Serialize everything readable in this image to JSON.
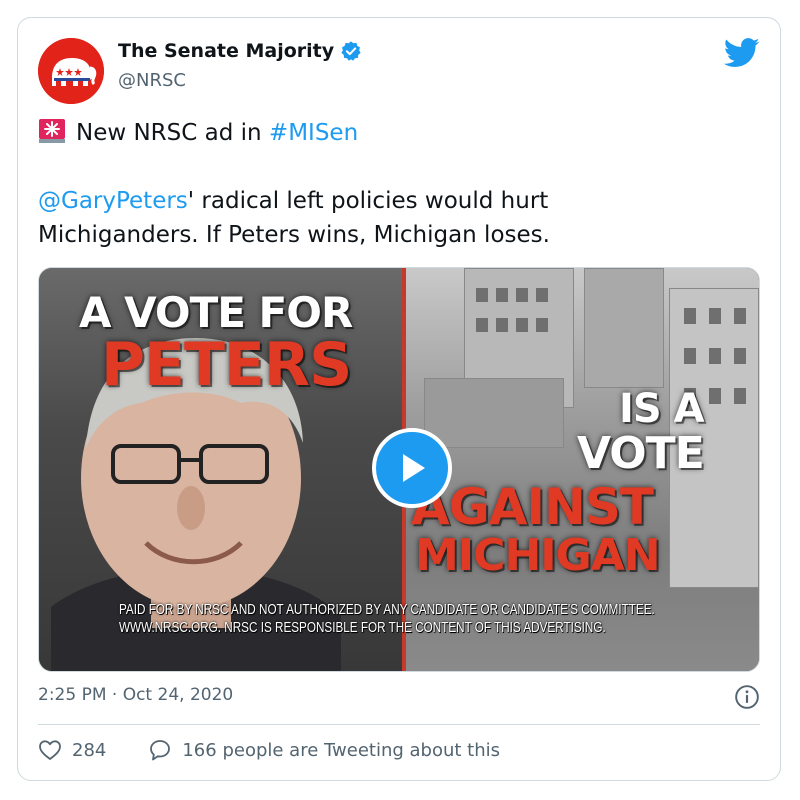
{
  "author": {
    "display_name": "The Senate Majority",
    "handle": "@NRSC",
    "verified": true,
    "avatar": "nrsc-elephant-logo"
  },
  "tweet": {
    "line1_text": "New NRSC ad in ",
    "line1_hashtag": "#MISen",
    "line1_icon": "rotating-light-emoji",
    "mention": "@GaryPeters",
    "body_after_mention": "' radical left policies would hurt",
    "body_line2": "Michiganders. If Peters wins, Michigan loses."
  },
  "media": {
    "type": "video",
    "overlay_left_line1": "A VOTE FOR",
    "overlay_left_line2": "PETERS",
    "overlay_right_line1": "IS A",
    "overlay_right_line2": "VOTE",
    "overlay_right_line3": "AGAINST",
    "overlay_right_line4": "MICHIGAN",
    "disclaimer_line1": "PAID FOR BY NRSC AND NOT AUTHORIZED BY ANY CANDIDATE OR CANDIDATE'S COMMITTEE.",
    "disclaimer_line2": "WWW.NRSC.ORG. NRSC IS RESPONSIBLE FOR THE CONTENT OF THIS ADVERTISING."
  },
  "timestamp": "2:25 PM · Oct 24, 2020",
  "actions": {
    "likes": "284",
    "conversation": "166 people are Tweeting about this"
  },
  "colors": {
    "link": "#1d9bf0",
    "muted": "#536471",
    "avatar_red": "#e2231a",
    "ad_red": "#e03a24"
  }
}
